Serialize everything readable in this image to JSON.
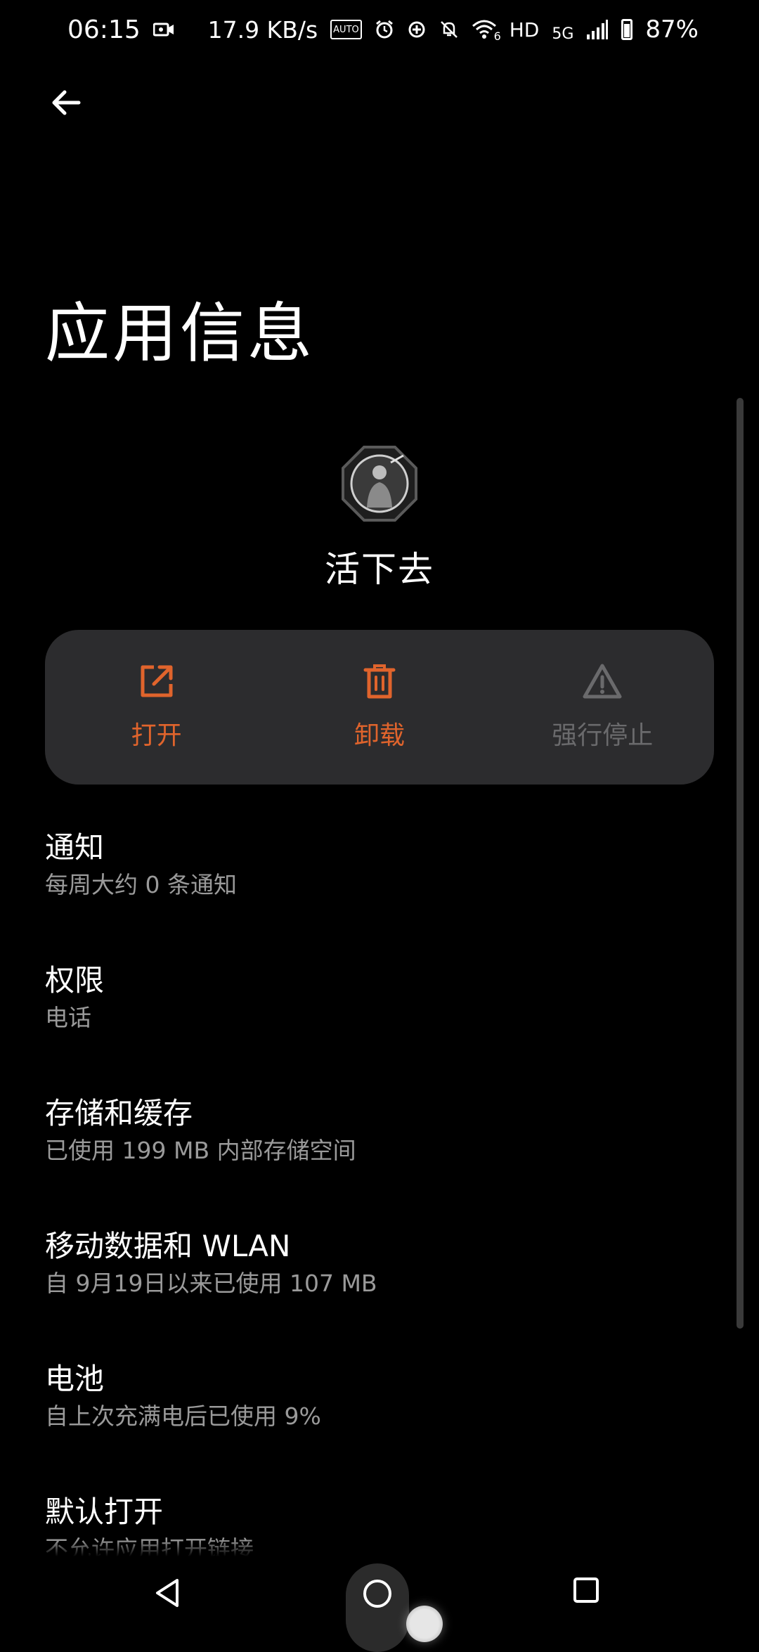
{
  "status_bar": {
    "time": "06:15",
    "net_speed": "17.9 KB/s",
    "auto_label": "AUTO",
    "wifi_badge": "6",
    "hd": "HD",
    "net_type": "5G",
    "battery": "87%",
    "icons": [
      "screen-record-icon",
      "auto-brightness-icon",
      "alarm-icon",
      "data-saver-icon",
      "bell-off-icon",
      "wifi-icon",
      "signal-icon",
      "battery-icon"
    ]
  },
  "header": {
    "title": "应用信息"
  },
  "app": {
    "name": "活下去"
  },
  "actions": [
    {
      "label": "打开",
      "icon": "open-external-icon",
      "enabled": true,
      "color": "#e0642c"
    },
    {
      "label": "卸载",
      "icon": "trash-icon",
      "enabled": true,
      "color": "#e0642c"
    },
    {
      "label": "强行停止",
      "icon": "warning-icon",
      "enabled": false,
      "color": "#6a6a6c"
    }
  ],
  "settings": [
    {
      "title": "通知",
      "subtitle": "每周大约 0 条通知"
    },
    {
      "title": "权限",
      "subtitle": "电话"
    },
    {
      "title": "存储和缓存",
      "subtitle": "已使用 199 MB 内部存储空间"
    },
    {
      "title": "移动数据和 WLAN",
      "subtitle": "自 9月19日以来已使用 107 MB"
    },
    {
      "title": "电池",
      "subtitle": "自上次充满电后已使用 9%"
    },
    {
      "title": "默认打开",
      "subtitle": "不允许应用打开链接"
    }
  ],
  "nav": [
    "back-icon",
    "home-icon",
    "recents-icon"
  ],
  "colors": {
    "background": "#000000",
    "panel": "#2c2c2e",
    "accent": "#e0642c",
    "secondary_text": "#9a9a9a"
  }
}
